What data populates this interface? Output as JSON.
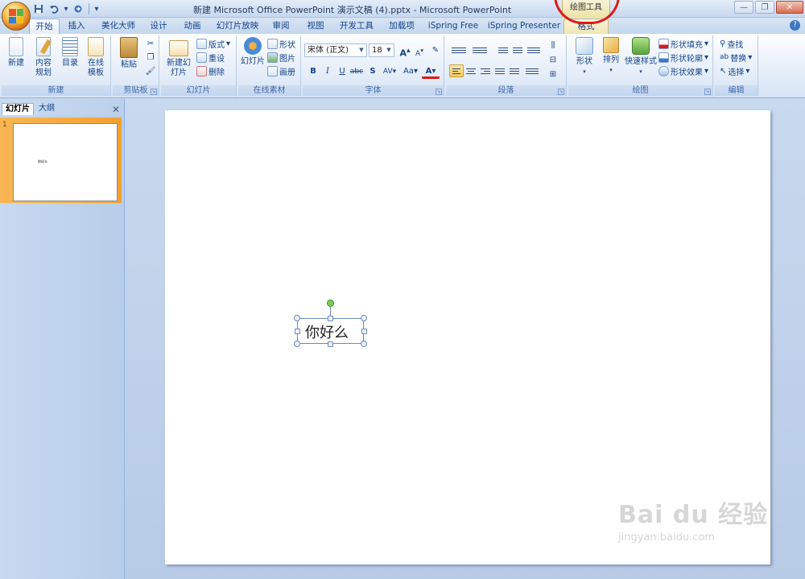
{
  "window": {
    "title": "新建 Microsoft Office PowerPoint 演示文稿 (4).pptx - Microsoft PowerPoint",
    "context_tab_label": "绘图工具",
    "minimize": "—",
    "restore": "❐",
    "close": "✕"
  },
  "ribbon_tabs": [
    {
      "label": "开始",
      "active": true
    },
    {
      "label": "插入"
    },
    {
      "label": "美化大师"
    },
    {
      "label": "设计"
    },
    {
      "label": "动画"
    },
    {
      "label": "幻灯片放映"
    },
    {
      "label": "审阅"
    },
    {
      "label": "视图"
    },
    {
      "label": "开发工具"
    },
    {
      "label": "加载项"
    },
    {
      "label": "iSpring Free"
    },
    {
      "label": "iSpring Presenter"
    },
    {
      "label": "格式",
      "contextual": true
    }
  ],
  "groups": {
    "new": {
      "label": "新建",
      "buttons": [
        "新建",
        "内容规划",
        "目录",
        "在线模板"
      ]
    },
    "clipboard": {
      "label": "剪贴板",
      "paste": "粘贴"
    },
    "slides": {
      "label": "幻灯片",
      "new_slide": "新建幻灯片",
      "layout": "版式",
      "reset": "重设",
      "delete": "删除"
    },
    "online": {
      "label": "在线素材",
      "slide": "幻灯片",
      "shape": "形状",
      "picture": "图片",
      "album": "画册"
    },
    "font": {
      "label": "字体",
      "font_name": "宋体 (正文)",
      "font_size": "18",
      "bold": "B",
      "italic": "I",
      "underline": "U",
      "strike": "abc",
      "shadow": "S",
      "spacing": "AV",
      "case": "Aa",
      "color": "A",
      "grow": "A",
      "shrink": "A"
    },
    "paragraph": {
      "label": "段落"
    },
    "drawing": {
      "label": "绘图",
      "shapes": "形状",
      "arrange": "排列",
      "quick_styles": "快速样式",
      "fill": "形状填充",
      "outline": "形状轮廓",
      "effects": "形状效果"
    },
    "editing": {
      "label": "编辑",
      "find": "查找",
      "replace": "替换",
      "select": "选择"
    }
  },
  "left_pane": {
    "tab_slides": "幻灯片",
    "tab_outline": "大纲",
    "close": "✕",
    "thumbnail_number": "1"
  },
  "slide": {
    "textbox_text": "你好么"
  },
  "watermark": {
    "main": "Bai du 经验",
    "sub": "jingyan.baidu.com"
  },
  "colors": {
    "accent_orange": "#f3a030",
    "annotation_red": "#e01818",
    "ribbon_text": "#15428b"
  }
}
